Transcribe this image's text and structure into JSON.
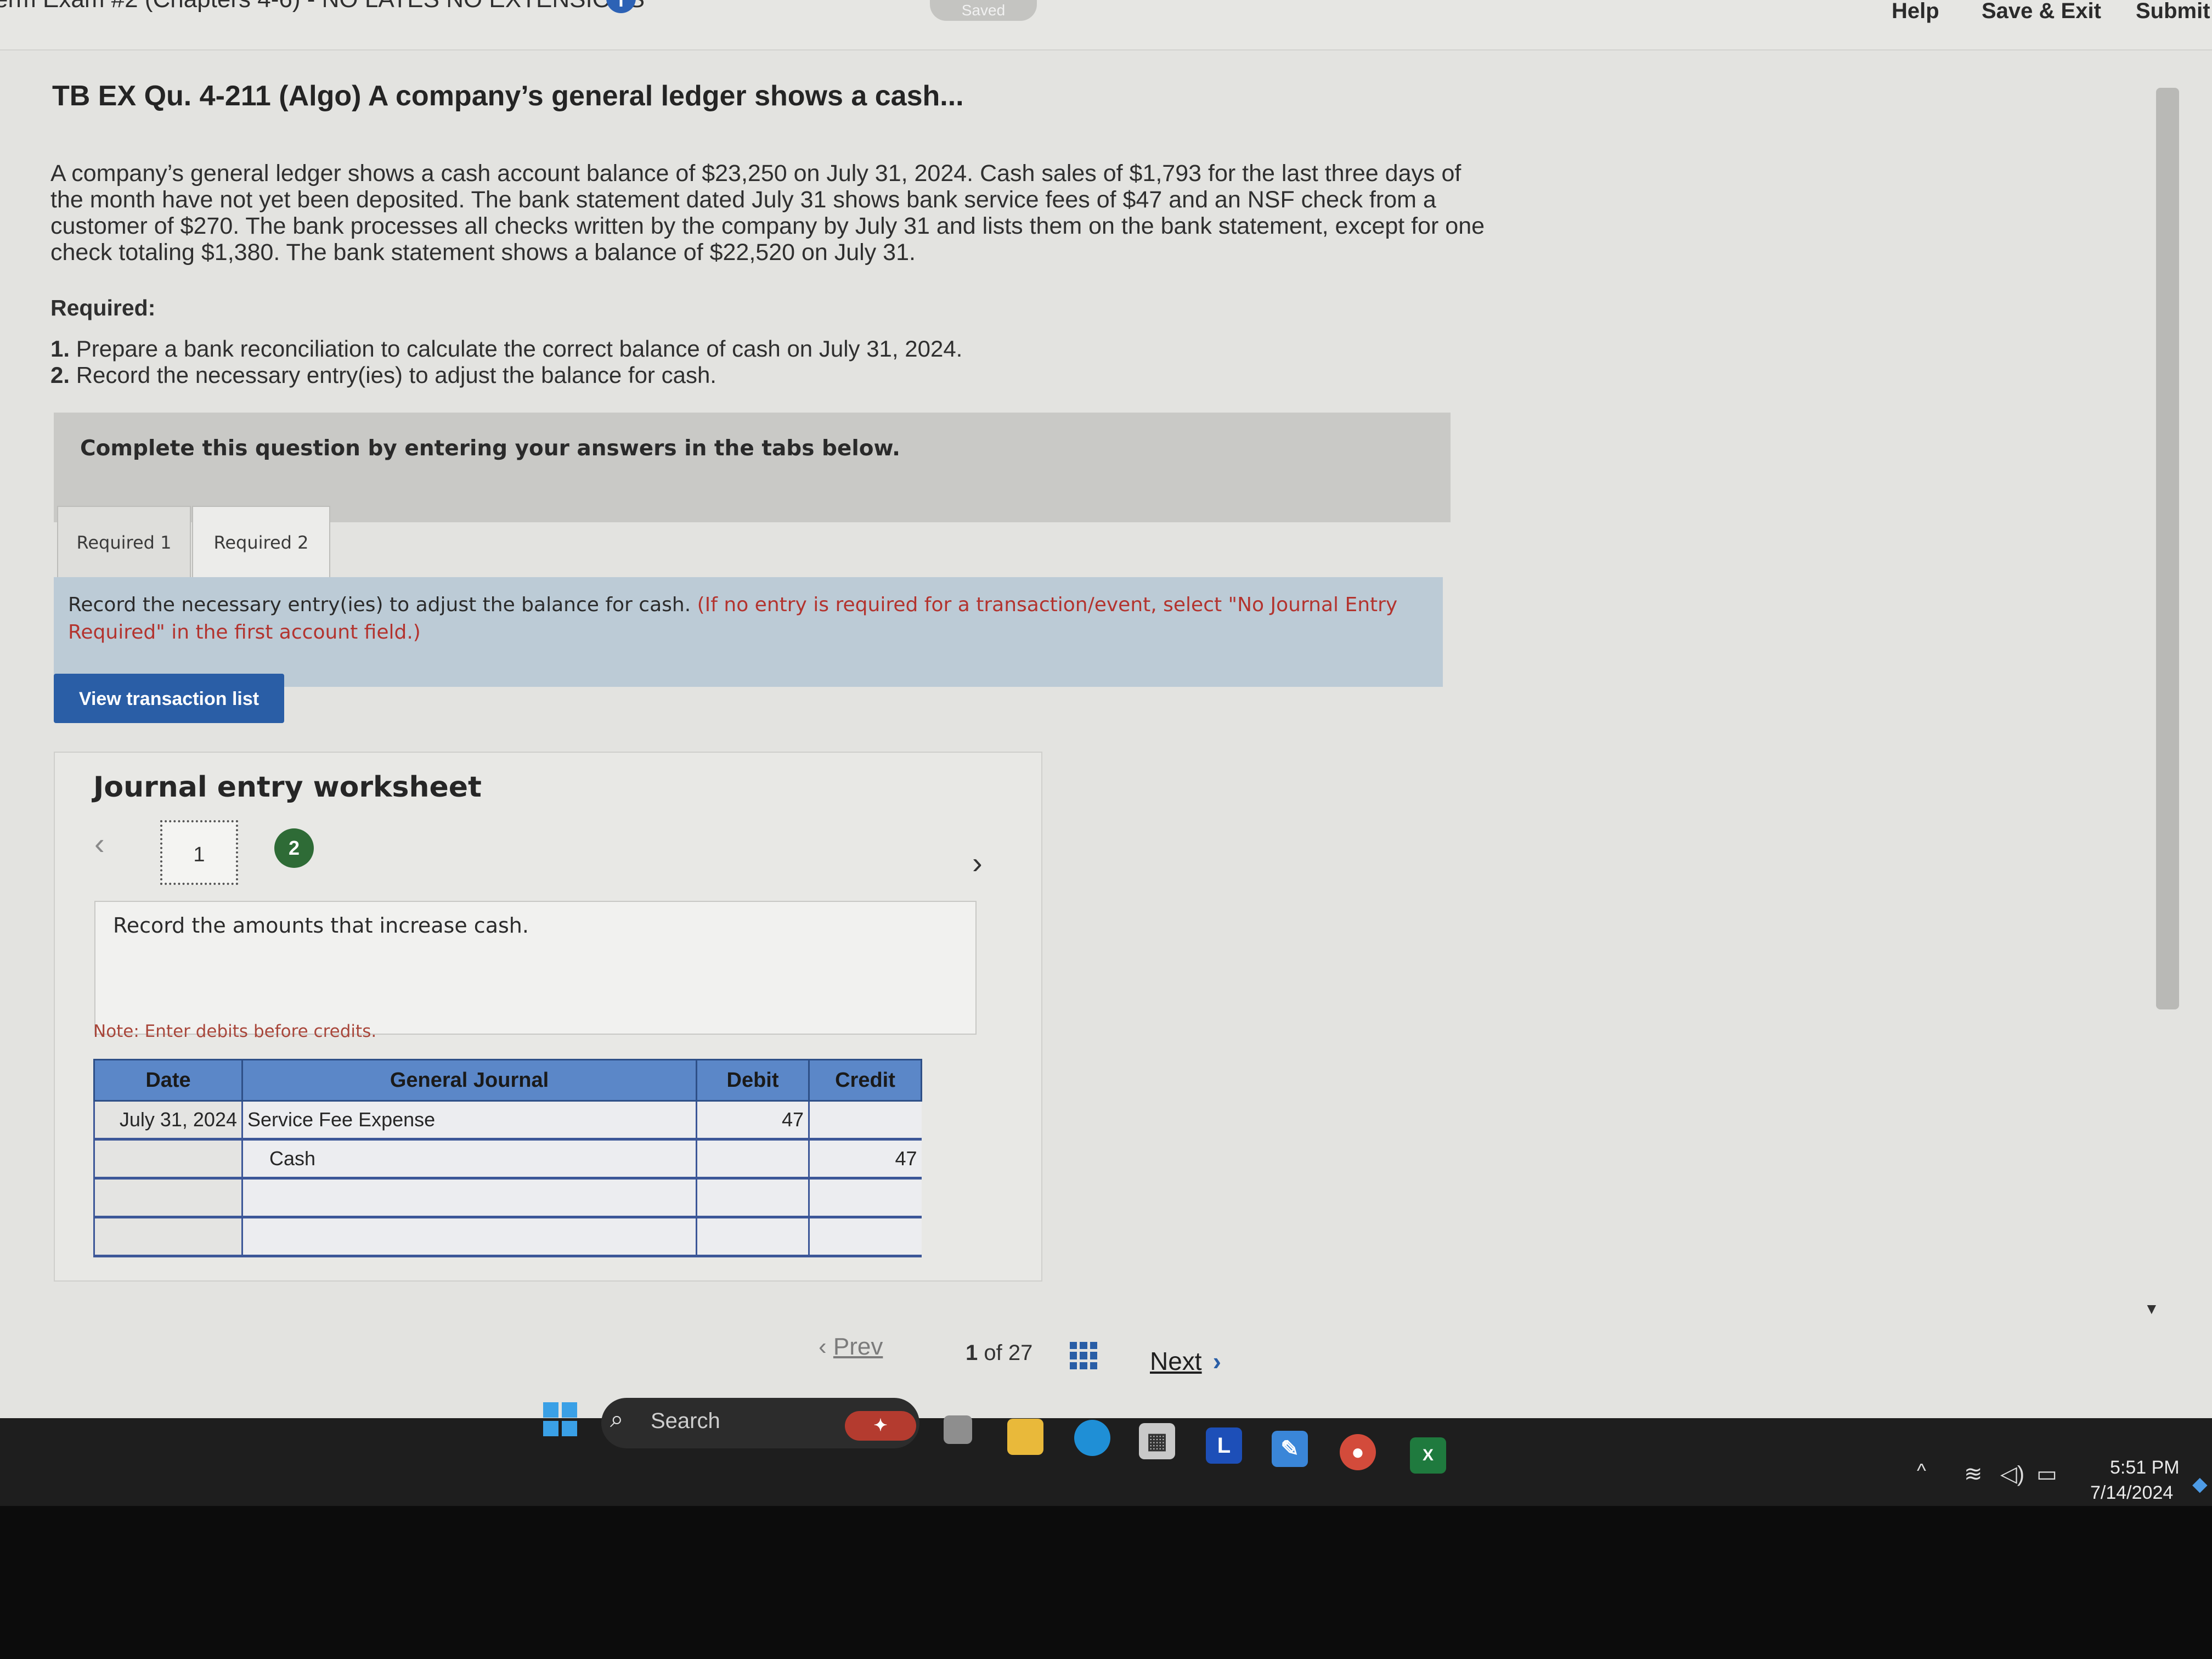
{
  "header": {
    "exam_title": "erm Exam #2 (Chapters 4-6) - NO LATES NO EXTENSIONS",
    "info_icon": "i",
    "saved_status": "Saved",
    "help_label": "Help",
    "save_exit_label": "Save & Exit",
    "submit_label": "Submit"
  },
  "question": {
    "title": "TB EX Qu. 4-211 (Algo) A company’s general ledger shows a cash...",
    "body": "A company’s general ledger shows a cash account balance of $23,250 on July 31, 2024. Cash sales of $1,793 for the last three days of the month have not yet been deposited. The bank statement dated July 31 shows bank service fees of $47 and an NSF check from a customer of $270. The bank processes all checks written by the company by July 31 and lists them on the bank statement, except for one check totaling $1,380. The bank statement shows a balance of $22,520 on July 31.",
    "required_heading": "Required:",
    "requirements": [
      {
        "num": "1.",
        "text": "Prepare a bank reconciliation to calculate the correct balance of cash on July 31, 2024."
      },
      {
        "num": "2.",
        "text": "Record the necessary entry(ies) to adjust the balance for cash."
      }
    ]
  },
  "instructions": "Complete this question by entering your answers in the tabs below.",
  "tabs": [
    {
      "label": "Required 1",
      "active": false
    },
    {
      "label": "Required 2",
      "active": true
    }
  ],
  "tab_panel": {
    "text": "Record the necessary entry(ies) to adjust the balance for cash.",
    "red_text": "(If no entry is required for a transaction/event, select \"No Journal Entry Required\" in the first account field.)"
  },
  "view_transaction_label": "View transaction list",
  "worksheet": {
    "title": "Journal entry worksheet",
    "entries": [
      "1",
      "2"
    ],
    "current_entry": "1",
    "description": "Record the amounts that increase cash.",
    "note": "Note: Enter debits before credits.",
    "columns": [
      "Date",
      "General Journal",
      "Debit",
      "Credit"
    ],
    "rows": [
      {
        "date": "July 31, 2024",
        "account": "Service Fee Expense",
        "debit": "47",
        "credit": ""
      },
      {
        "date": "",
        "account": "Cash",
        "debit": "",
        "credit": "47"
      },
      {
        "date": "",
        "account": "",
        "debit": "",
        "credit": ""
      },
      {
        "date": "",
        "account": "",
        "debit": "",
        "credit": ""
      }
    ]
  },
  "pagination": {
    "prev_label": "Prev",
    "current": "1",
    "of_label": "of",
    "total": "27",
    "next_label": "Next"
  },
  "taskbar": {
    "search_label": "Search",
    "l_app_label": "L",
    "excel_label": "X",
    "time": "5:51 PM",
    "date": "7/14/2024"
  },
  "colors": {
    "primary_button": "#2a5ea6",
    "table_header": "#5b87c8",
    "note_red": "#b3332e",
    "entry_badge": "#2e6b36"
  },
  "icons": [
    "info-icon",
    "chevron-left-icon",
    "chevron-right-icon",
    "grid-icon",
    "windows-start-icon",
    "search-icon",
    "wifi-icon",
    "volume-icon",
    "battery-icon"
  ]
}
